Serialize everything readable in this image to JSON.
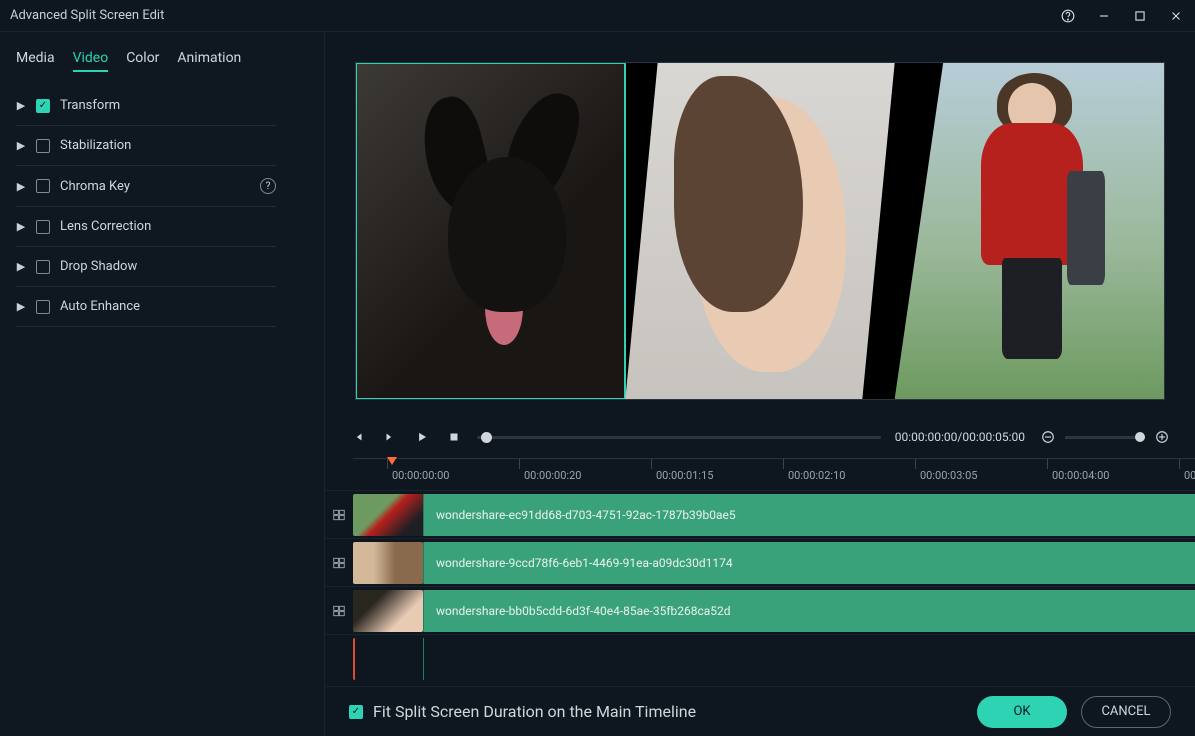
{
  "window": {
    "title": "Advanced Split Screen Edit"
  },
  "tabs": [
    "Media",
    "Video",
    "Color",
    "Animation"
  ],
  "activeTab": 1,
  "options": [
    {
      "label": "Transform",
      "checked": true
    },
    {
      "label": "Stabilization",
      "checked": false
    },
    {
      "label": "Chroma Key",
      "checked": false,
      "help": true
    },
    {
      "label": "Lens Correction",
      "checked": false
    },
    {
      "label": "Drop Shadow",
      "checked": false
    },
    {
      "label": "Auto Enhance",
      "checked": false
    }
  ],
  "playback": {
    "current": "00:00:00:00",
    "total": "00:00:05:00",
    "timecode": "00:00:00:00/00:00:05:00"
  },
  "ruler": [
    "00:00:00:00",
    "00:00:00:20",
    "00:00:01:15",
    "00:00:02:10",
    "00:00:03:05",
    "00:00:04:00",
    "00:00:0"
  ],
  "clips": [
    "wondershare-ec91dd68-d703-4751-92ac-1787b39b0ae5",
    "wondershare-9ccd78f6-6eb1-4469-91ea-a09dc30d1174",
    "wondershare-bb0b5cdd-6d3f-40e4-85ae-35fb268ca52d"
  ],
  "footer": {
    "fitLabel": "Fit Split Screen Duration on the Main Timeline",
    "fitChecked": true,
    "ok": "OK",
    "cancel": "CANCEL"
  }
}
